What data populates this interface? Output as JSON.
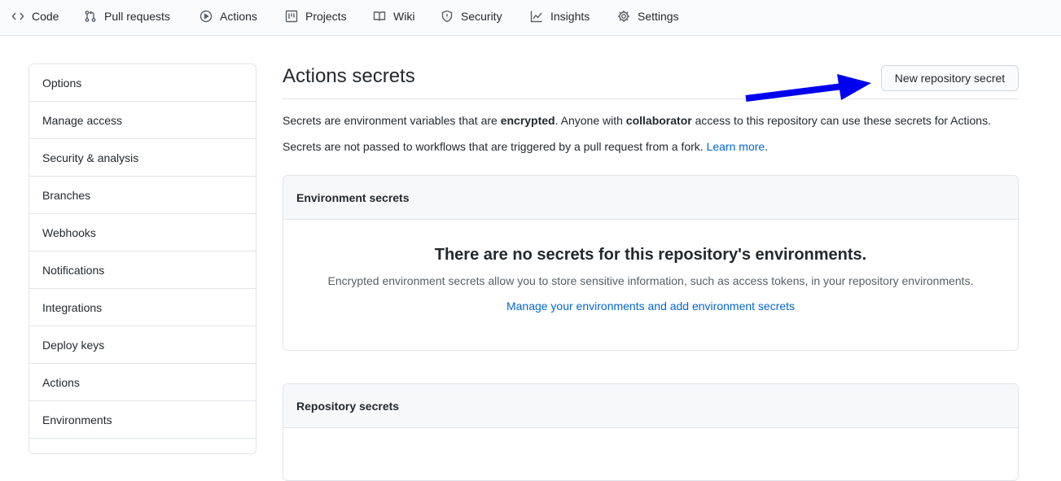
{
  "topnav": {
    "tabs": [
      {
        "label": "Code",
        "icon": "code-icon"
      },
      {
        "label": "Pull requests",
        "icon": "git-pull-request-icon"
      },
      {
        "label": "Actions",
        "icon": "play-icon"
      },
      {
        "label": "Projects",
        "icon": "project-icon"
      },
      {
        "label": "Wiki",
        "icon": "book-icon"
      },
      {
        "label": "Security",
        "icon": "shield-icon"
      },
      {
        "label": "Insights",
        "icon": "graph-icon"
      },
      {
        "label": "Settings",
        "icon": "gear-icon"
      }
    ]
  },
  "sidebar": {
    "items": [
      {
        "label": "Options"
      },
      {
        "label": "Manage access"
      },
      {
        "label": "Security & analysis"
      },
      {
        "label": "Branches"
      },
      {
        "label": "Webhooks"
      },
      {
        "label": "Notifications"
      },
      {
        "label": "Integrations"
      },
      {
        "label": "Deploy keys"
      },
      {
        "label": "Actions"
      },
      {
        "label": "Environments"
      }
    ]
  },
  "main": {
    "title": "Actions secrets",
    "new_secret_button": "New repository secret",
    "description_1": {
      "part1": "Secrets are environment variables that are ",
      "bold1": "encrypted",
      "part2": ". Anyone with ",
      "bold2": "collaborator",
      "part3": " access to this repository can use these secrets for Actions."
    },
    "description_2": {
      "text": "Secrets are not passed to workflows that are triggered by a pull request from a fork. ",
      "link": "Learn more",
      "end": "."
    },
    "environment_secrets": {
      "header": "Environment secrets",
      "empty_title": "There are no secrets for this repository's environments.",
      "empty_desc": "Encrypted environment secrets allow you to store sensitive information, such as access tokens, in your repository environments.",
      "empty_link": "Manage your environments and add environment secrets"
    },
    "repository_secrets": {
      "header": "Repository secrets"
    }
  },
  "annotation": {
    "arrow_color": "#0000ee"
  },
  "colors": {
    "link": "#0366d6",
    "border": "#e1e4e8",
    "header_bg": "#f6f8fa"
  }
}
